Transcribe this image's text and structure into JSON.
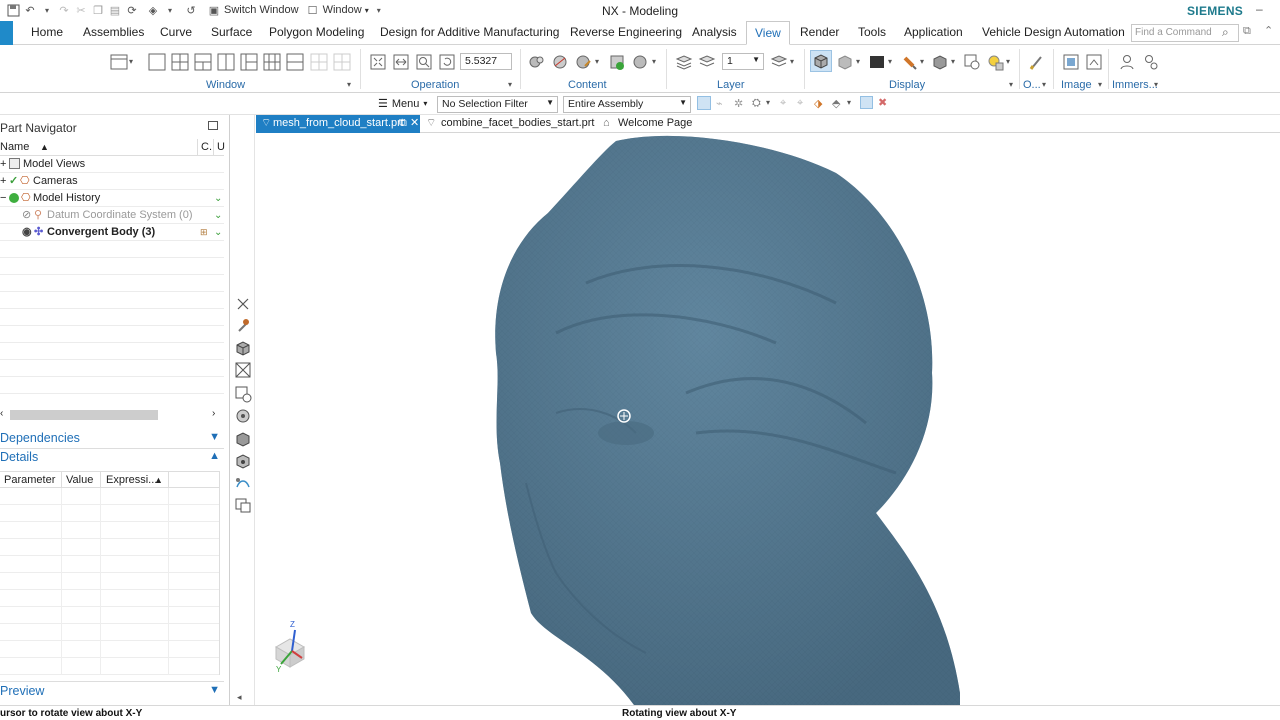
{
  "window": {
    "title": "NX - Modeling",
    "brand": "SIEMENS",
    "switch_window_label": "Switch Window",
    "window_menu_label": "Window"
  },
  "ribbon_tabs": [
    {
      "label": "Home"
    },
    {
      "label": "Assemblies"
    },
    {
      "label": "Curve"
    },
    {
      "label": "Surface"
    },
    {
      "label": "Polygon Modeling"
    },
    {
      "label": "Design for Additive Manufacturing"
    },
    {
      "label": "Reverse Engineering"
    },
    {
      "label": "Analysis"
    },
    {
      "label": "View"
    },
    {
      "label": "Render"
    },
    {
      "label": "Tools"
    },
    {
      "label": "Application"
    },
    {
      "label": "Vehicle Design Automation"
    }
  ],
  "active_tab": "View",
  "find_command": {
    "placeholder": "Find a Command"
  },
  "ribbon_groups": {
    "window": "Window",
    "operation": "Operation",
    "content": "Content",
    "layer": "Layer",
    "display": "Display",
    "o": "O...",
    "image": "Image",
    "immersive": "Immers..."
  },
  "zoom_value": "5.5327",
  "layer_value": "1",
  "selection_bar": {
    "menu_label": "Menu",
    "filter": "No Selection Filter",
    "scope": "Entire Assembly"
  },
  "part_navigator": {
    "title": "Part Navigator",
    "columns": {
      "name": "Name",
      "c": "C.",
      "u": "U"
    },
    "nodes": [
      {
        "label": "Model Views",
        "expander": "+"
      },
      {
        "label": "Cameras",
        "expander": "+"
      },
      {
        "label": "Model History",
        "expander": "−"
      },
      {
        "label": "Datum Coordinate System (0)",
        "expander": ""
      },
      {
        "label": "Convergent Body (3)",
        "expander": ""
      }
    ]
  },
  "sections": {
    "dependencies": "Dependencies",
    "details": "Details",
    "preview": "Preview"
  },
  "details_columns": [
    "Parameter",
    "Value",
    "Expressi..."
  ],
  "doc_tabs": [
    {
      "label": "mesh_from_cloud_start.prt"
    },
    {
      "label": "combine_facet_bodies_start.prt"
    },
    {
      "label": "Welcome Page"
    }
  ],
  "triad": {
    "z_label": "Z",
    "y_label": "Y"
  },
  "status": {
    "left": "ursor to rotate view about X-Y",
    "center": "Rotating view about X-Y"
  },
  "colors": {
    "accent": "#1f6fb7",
    "active_tab_bg": "#1f7fc4",
    "model_fill": "#557a93"
  }
}
